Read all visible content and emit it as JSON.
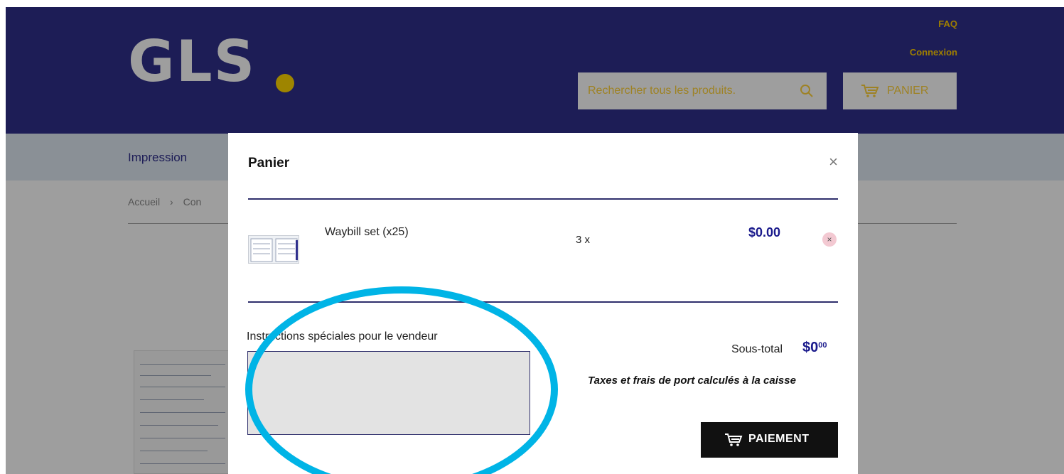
{
  "header": {
    "logo_text": "GLS",
    "faq_link": "FAQ",
    "login_link": "Connexion",
    "search_placeholder": "Rechercher tous les produits.",
    "cart_label": "PANIER"
  },
  "nav": {
    "items": [
      "Impression"
    ]
  },
  "breadcrumb": [
    "Accueil",
    "›",
    "Con"
  ],
  "cart_modal": {
    "title": "Panier",
    "close_symbol": "×",
    "items": [
      {
        "name": "Waybill set (x25)",
        "quantity": "3 x",
        "price": "$0.00",
        "remove_symbol": "×"
      }
    ],
    "instructions_label": "Instructions spéciales pour le vendeur",
    "instructions_value": "",
    "subtotal_label": "Sous-total",
    "subtotal_main": "$0",
    "subtotal_cents": "00",
    "tax_note": "Taxes et frais de port calculés à la caisse",
    "checkout_label": "PAIEMENT"
  },
  "colors": {
    "brand_blue": "#2f2f8c",
    "brand_yellow": "#ffd700",
    "highlight_ring": "#00b4e6",
    "price_blue": "#1a1a8c"
  },
  "icons": [
    "search-icon",
    "cart-icon",
    "close-icon",
    "remove-icon"
  ]
}
